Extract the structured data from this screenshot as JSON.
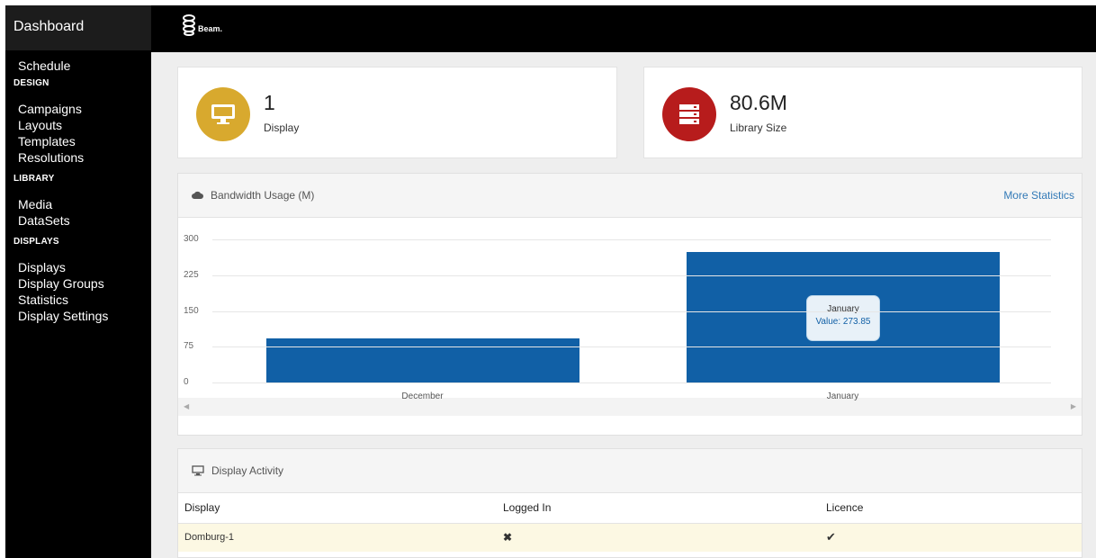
{
  "sidebar": {
    "header": "Dashboard",
    "top_items": [
      {
        "label": "Schedule"
      }
    ],
    "sections": [
      {
        "heading": "DESIGN",
        "items": [
          {
            "label": "Campaigns"
          },
          {
            "label": "Layouts"
          },
          {
            "label": "Templates"
          },
          {
            "label": "Resolutions"
          }
        ]
      },
      {
        "heading": "LIBRARY",
        "items": [
          {
            "label": "Media"
          },
          {
            "label": "DataSets"
          }
        ]
      },
      {
        "heading": "DISPLAYS",
        "items": [
          {
            "label": "Displays"
          },
          {
            "label": "Display Groups"
          },
          {
            "label": "Statistics"
          },
          {
            "label": "Display Settings"
          }
        ]
      }
    ]
  },
  "topbar": {
    "logo_text": "Beam."
  },
  "stats": [
    {
      "value": "1",
      "label": "Display",
      "icon": "monitor-icon",
      "color": "#d8a92e"
    },
    {
      "value": "80.6M",
      "label": "Library Size",
      "icon": "server-icon",
      "color": "#b71c1c"
    }
  ],
  "bandwidth": {
    "title": "Bandwidth Usage (M)",
    "more_link": "More Statistics",
    "tooltip": {
      "title": "January",
      "value_text": "Value: 273.85"
    }
  },
  "chart_data": {
    "type": "bar",
    "categories": [
      "December",
      "January"
    ],
    "values": [
      93,
      273.85
    ],
    "ylim": [
      0,
      300
    ],
    "yticks": [
      "0",
      "75",
      "150",
      "225",
      "300"
    ],
    "color": "#1160a6",
    "grid": true
  },
  "activity": {
    "title": "Display Activity",
    "columns": [
      "Display",
      "Logged In",
      "Licence"
    ],
    "rows": [
      [
        "Domburg-1",
        "✖",
        "✔"
      ]
    ]
  }
}
